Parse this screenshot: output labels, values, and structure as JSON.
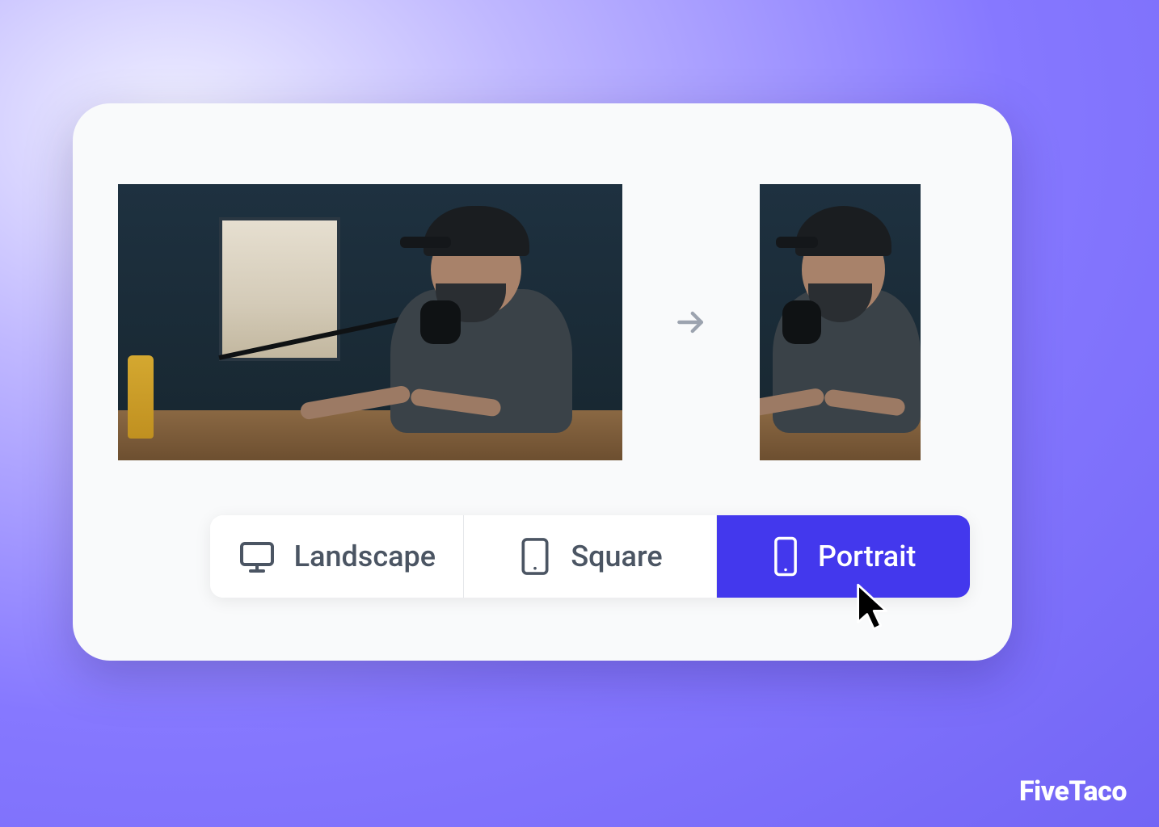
{
  "options": {
    "landscape": {
      "label": "Landscape",
      "selected": false
    },
    "square": {
      "label": "Square",
      "selected": false
    },
    "portrait": {
      "label": "Portrait",
      "selected": true
    }
  },
  "watermark": "FiveTaco",
  "colors": {
    "accent": "#4338ed",
    "text": "#4b5563"
  }
}
